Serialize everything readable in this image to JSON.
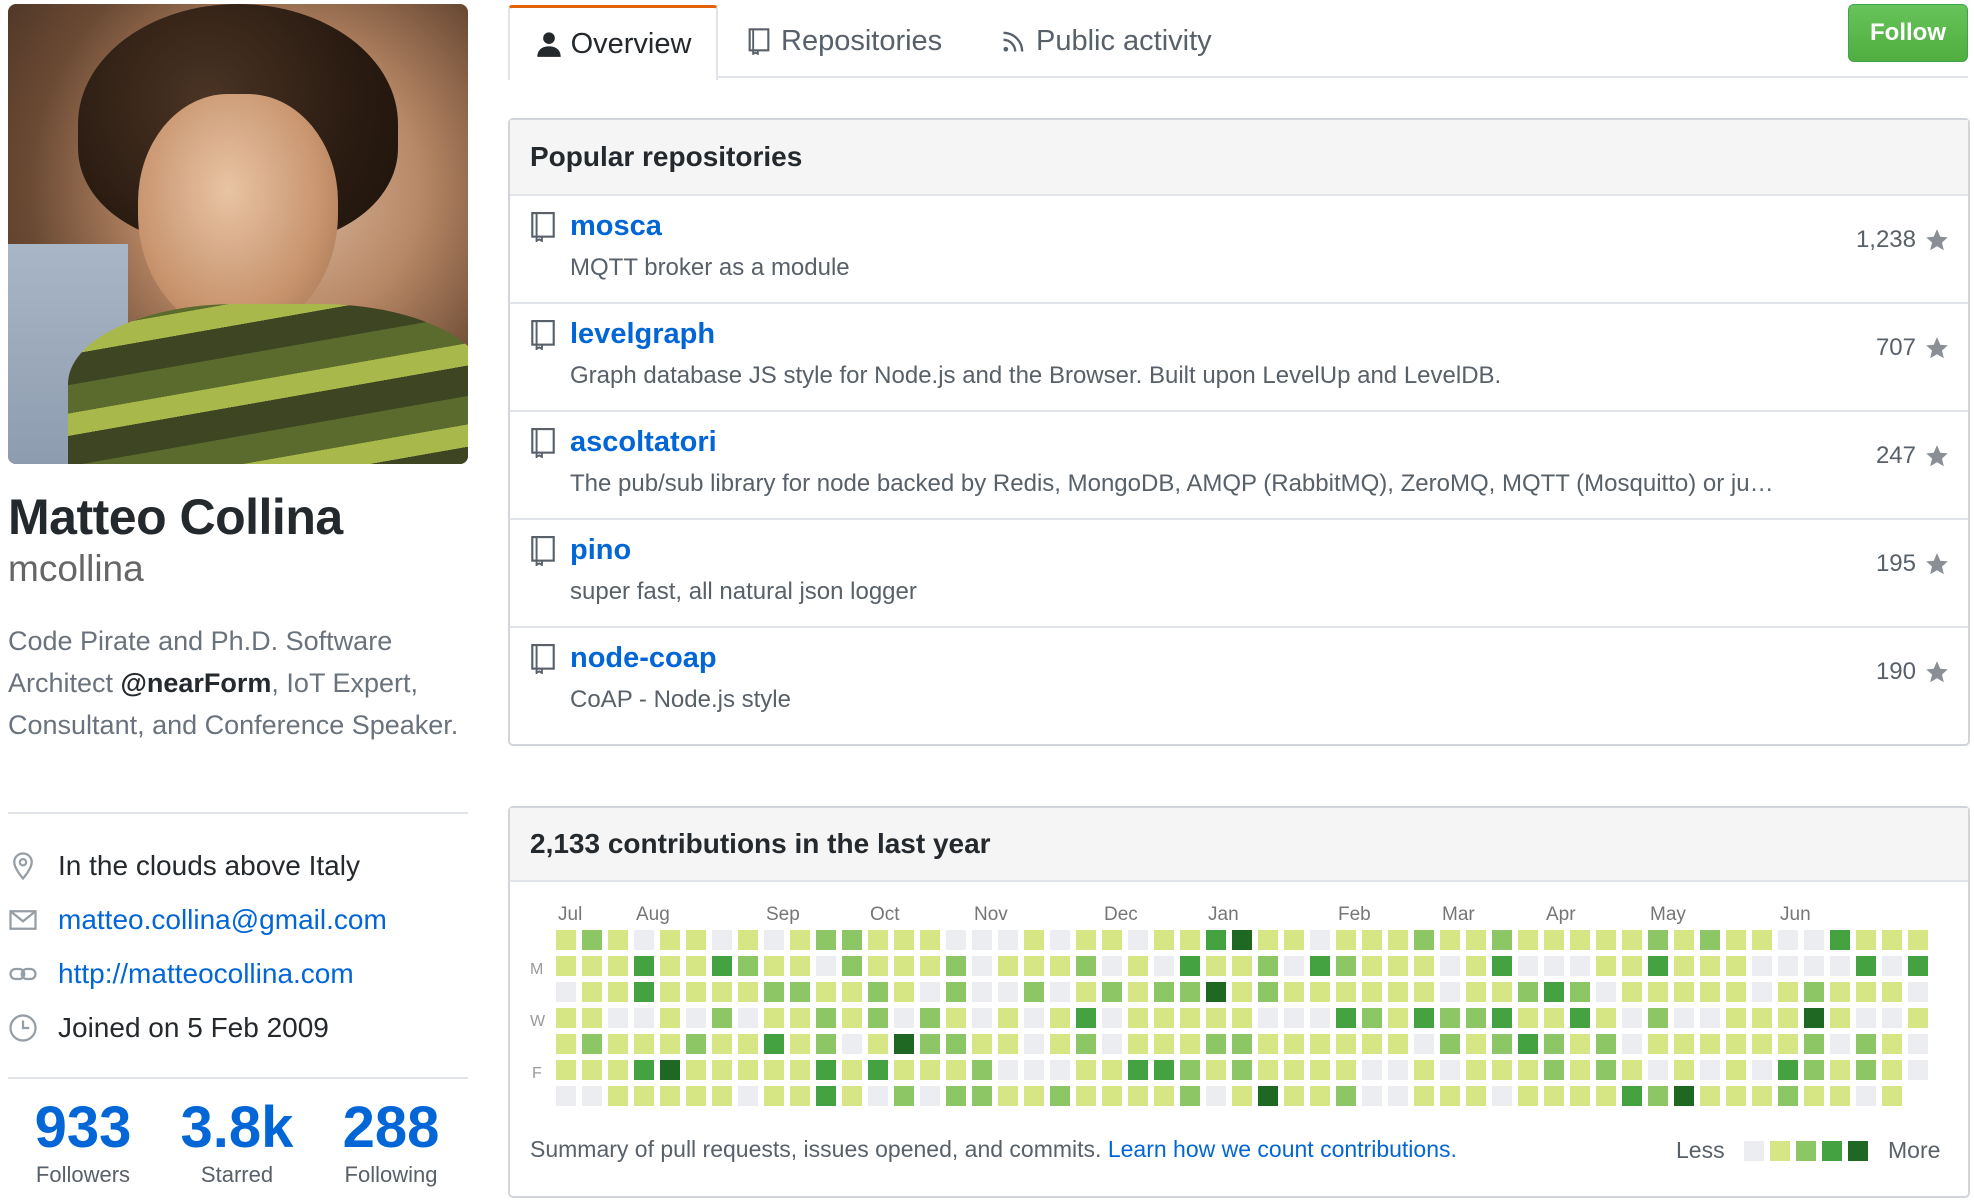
{
  "profile": {
    "name": "Matteo Collina",
    "username": "mcollina",
    "bio_before": "Code Pirate and Ph.D. Software Architect ",
    "bio_org": "@nearForm",
    "bio_after": ", IoT Expert, Consultant, and Conference Speaker.",
    "location": "In the clouds above Italy",
    "email": "matteo.collina@gmail.com",
    "website": "http://matteocollina.com",
    "joined": "Joined on 5 Feb 2009"
  },
  "stats": [
    {
      "value": "933",
      "label": "Followers"
    },
    {
      "value": "3.8k",
      "label": "Starred"
    },
    {
      "value": "288",
      "label": "Following"
    }
  ],
  "tabs": [
    {
      "label": "Overview",
      "icon": "person-icon",
      "selected": true
    },
    {
      "label": "Repositories",
      "icon": "repo-icon",
      "selected": false
    },
    {
      "label": "Public activity",
      "icon": "rss-icon",
      "selected": false
    }
  ],
  "follow_label": "Follow",
  "popular": {
    "heading": "Popular repositories",
    "repos": [
      {
        "name": "mosca",
        "description": "MQTT broker as a module",
        "stars": "1,238"
      },
      {
        "name": "levelgraph",
        "description": "Graph database JS style for Node.js and the Browser. Built upon LevelUp and LevelDB.",
        "stars": "707"
      },
      {
        "name": "ascoltatori",
        "description": "The pub/sub library for node backed by Redis, MongoDB, AMQP (RabbitMQ), ZeroMQ, MQTT (Mosquitto) or ju…",
        "stars": "247"
      },
      {
        "name": "pino",
        "description": "super fast, all natural json logger",
        "stars": "195"
      },
      {
        "name": "node-coap",
        "description": "CoAP - Node.js style",
        "stars": "190"
      }
    ]
  },
  "contributions": {
    "heading": "2,133 contributions in the last year",
    "months": [
      "Jul",
      "Aug",
      "Sep",
      "Oct",
      "Nov",
      "Dec",
      "Jan",
      "Feb",
      "Mar",
      "Apr",
      "May",
      "Jun"
    ],
    "days": [
      "M",
      "W",
      "F"
    ],
    "summary": "Summary of pull requests, issues opened, and commits. ",
    "learn_link": "Learn how we count contributions.",
    "legend_less": "Less",
    "legend_more": "More",
    "colors": [
      "#ebedf0",
      "#d6e685",
      "#8cc665",
      "#44a340",
      "#1e6823"
    ]
  }
}
